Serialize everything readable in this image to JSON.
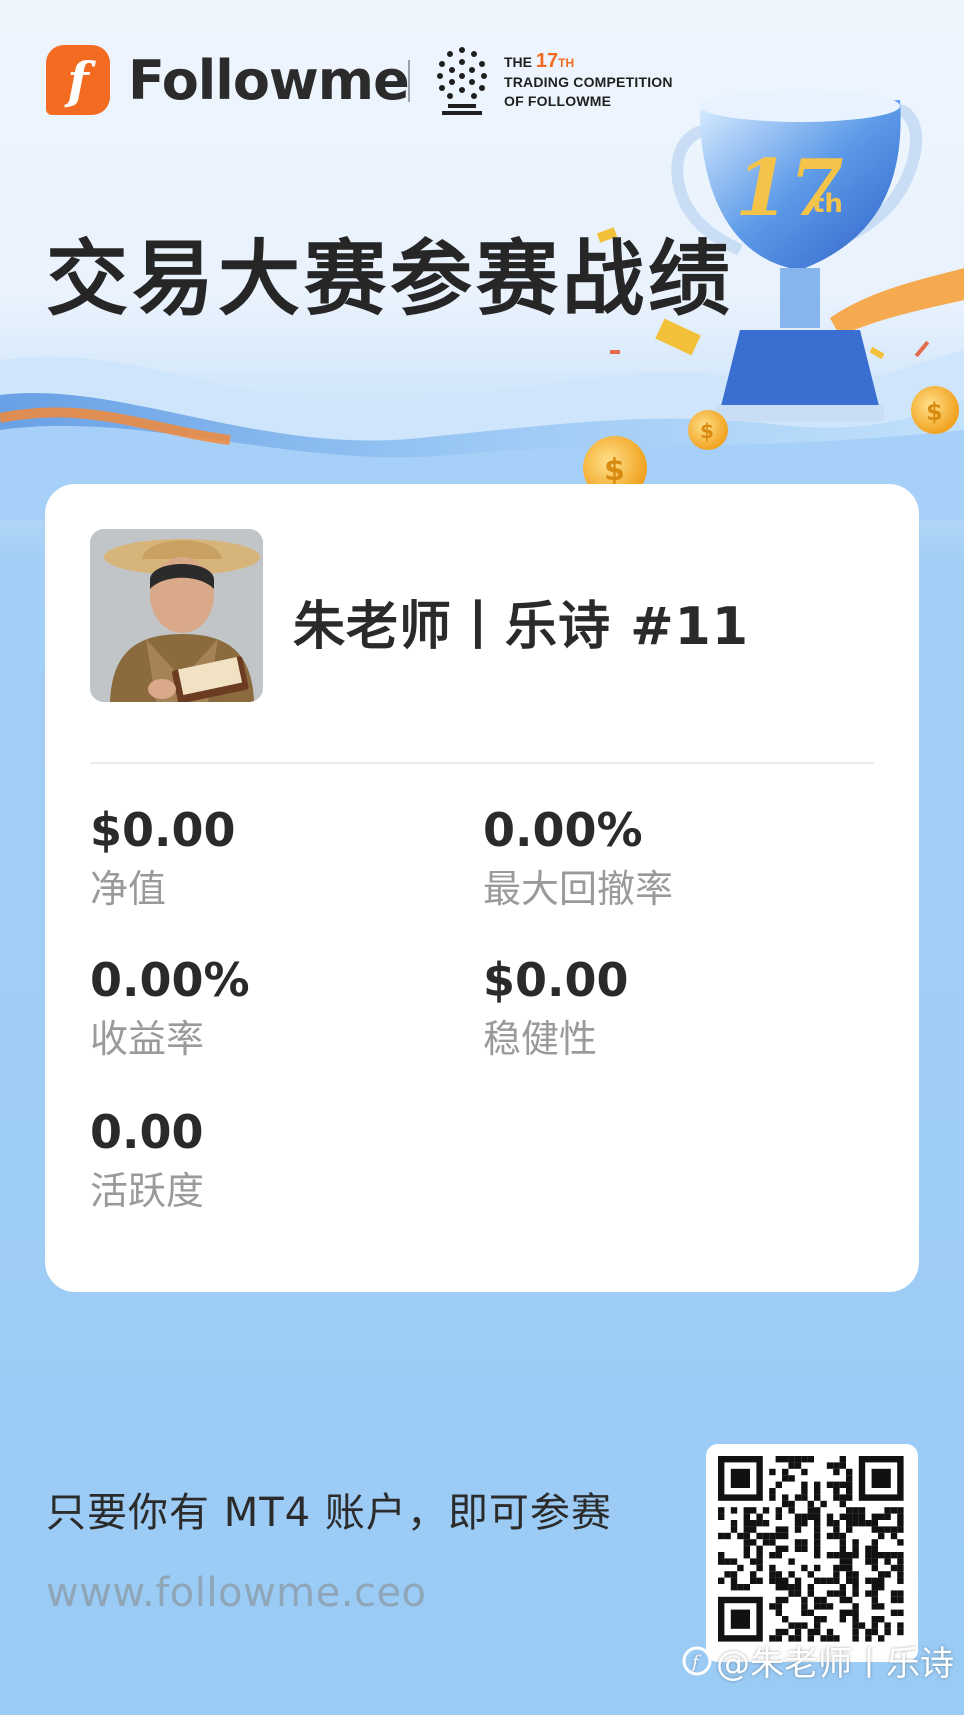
{
  "header": {
    "brand_name": "Followme",
    "competition": {
      "the": "THE",
      "number": "17",
      "suffix": "TH",
      "line2": "TRADING COMPETITION",
      "line3": "OF FOLLOWME"
    },
    "trophy_badge": "17",
    "trophy_badge_suffix": "th",
    "headline": "交易大赛参赛战绩"
  },
  "profile": {
    "name": "朱老师丨乐诗 #11"
  },
  "stats": [
    {
      "value": "$0.00",
      "label": "净值"
    },
    {
      "value": "0.00%",
      "label": "最大回撤率"
    },
    {
      "value": "0.00%",
      "label": "收益率"
    },
    {
      "value": "$0.00",
      "label": "稳健性"
    },
    {
      "value": "0.00",
      "label": "活跃度"
    }
  ],
  "footer": {
    "cta": "只要你有 MT4 账户，即可参赛",
    "website": "www.followme.ceo",
    "watermark": "@朱老师丨乐诗"
  },
  "colors": {
    "brand_orange": "#f26b21",
    "background_blue": "#9acbf5",
    "card": "#ffffff",
    "label_gray": "#9a9a9a"
  }
}
